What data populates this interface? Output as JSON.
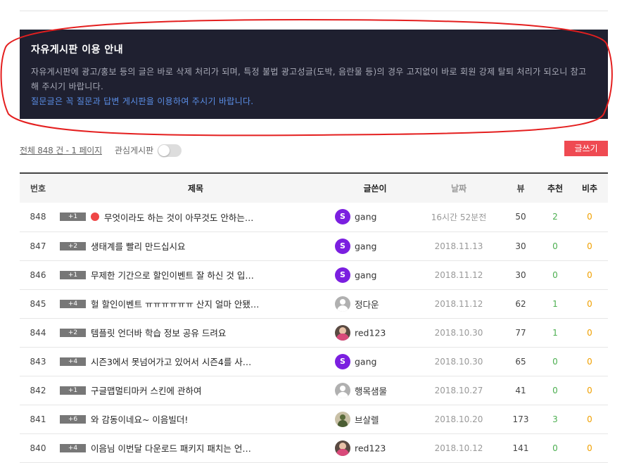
{
  "notice": {
    "title": "자유게시판 이용 안내",
    "body": "자유게시판에 광고/홍보 등의 글은 바로 삭제 처리가 되며, 특정 불법 광고성글(도박, 음란물 등)의 경우 고지없이 바로 회원 강제 탈퇴 처리가 되오니 참고 해 주시기 바랍니다.",
    "link": "질문글은 꼭 질문과 답변 게시판을 이용하여 주시기 바랍니다."
  },
  "summary": {
    "count_text": "전체 848 건 - 1 페이지",
    "fav_label": "관심게시판",
    "fav_on": false
  },
  "write_button": "글쓰기",
  "headers": {
    "num": "번호",
    "title": "제목",
    "writer": "글쓴이",
    "date": "날짜",
    "views": "뷰",
    "recommend": "추천",
    "not_recommend": "비추"
  },
  "posts": [
    {
      "num": "848",
      "badge": "+1",
      "new_dot": true,
      "title": "무엇이라도 하는 것이 아무것도 안하는…",
      "avatar": "s-icon",
      "writer": "gang",
      "date": "16시간 52분전",
      "views": "50",
      "rec": "2",
      "nrec": "0"
    },
    {
      "num": "847",
      "badge": "+2",
      "new_dot": false,
      "title": "생태계를 빨리 만드십시요",
      "avatar": "s-icon",
      "writer": "gang",
      "date": "2018.11.13",
      "views": "30",
      "rec": "0",
      "nrec": "0"
    },
    {
      "num": "846",
      "badge": "+1",
      "new_dot": false,
      "title": "무제한 기간으로 할인이벤트 잘 하신 것 입…",
      "avatar": "s-icon",
      "writer": "gang",
      "date": "2018.11.12",
      "views": "30",
      "rec": "0",
      "nrec": "0"
    },
    {
      "num": "845",
      "badge": "+4",
      "new_dot": false,
      "title": "헐 할인이벤트 ㅠㅠㅠㅠㅠㅠ 산지 얼마 안됐…",
      "avatar": "person-icon",
      "writer": "정다운",
      "date": "2018.11.12",
      "views": "62",
      "rec": "1",
      "nrec": "0"
    },
    {
      "num": "844",
      "badge": "+2",
      "new_dot": false,
      "title": "템플릿 언더바 학습 정보 공유 드려요",
      "avatar": "photo",
      "writer": "red123",
      "date": "2018.10.30",
      "views": "77",
      "rec": "1",
      "nrec": "0"
    },
    {
      "num": "843",
      "badge": "+4",
      "new_dot": false,
      "title": "시즌3에서 못넘어가고 있어서 시즌4를 사…",
      "avatar": "s-icon",
      "writer": "gang",
      "date": "2018.10.30",
      "views": "65",
      "rec": "0",
      "nrec": "0"
    },
    {
      "num": "842",
      "badge": "+1",
      "new_dot": false,
      "title": "구글맵멀티마커 스킨에 관하여",
      "avatar": "person-icon",
      "writer": "행목샘물",
      "date": "2018.10.27",
      "views": "41",
      "rec": "0",
      "nrec": "0"
    },
    {
      "num": "841",
      "badge": "+6",
      "new_dot": false,
      "title": "와 감동이네요~ 이음빌더!",
      "avatar": "photo2",
      "writer": "브살렐",
      "date": "2018.10.20",
      "views": "173",
      "rec": "3",
      "nrec": "0"
    },
    {
      "num": "840",
      "badge": "+4",
      "new_dot": false,
      "title": "이음님 이번달 다운로드 패키지 패치는 언…",
      "avatar": "photo",
      "writer": "red123",
      "date": "2018.10.12",
      "views": "141",
      "rec": "0",
      "nrec": "0"
    }
  ]
}
